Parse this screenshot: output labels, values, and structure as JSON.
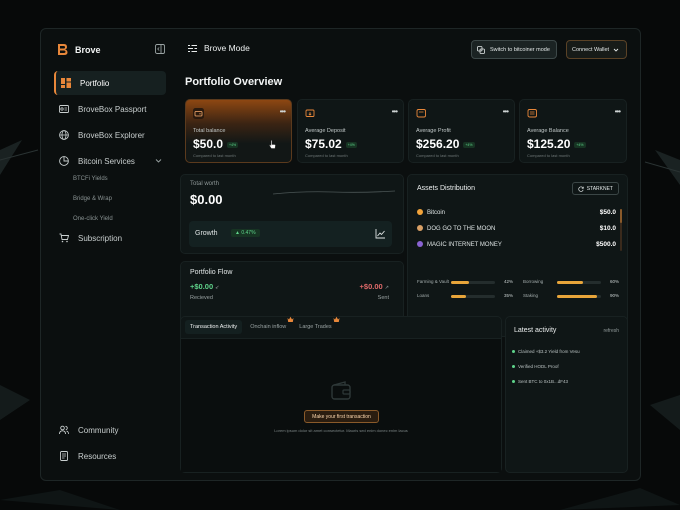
{
  "colors": {
    "accent": "#e8873a",
    "positive": "#5fd48b",
    "negative": "#e06a6a",
    "bar": "#e8a53a",
    "background": "#070909"
  },
  "brand": {
    "name": "Brove",
    "logo_icon": "brove-logo-icon"
  },
  "sidebar": {
    "items": [
      {
        "label": "Portfolio",
        "icon": "portfolio-grid-icon",
        "active": true
      },
      {
        "label": "BroveBox Passport",
        "icon": "passport-card-icon"
      },
      {
        "label": "BroveBox Explorer",
        "icon": "globe-icon"
      },
      {
        "label": "Bitcoin Services",
        "icon": "pie-chart-icon",
        "expanded": true,
        "children": [
          "BTCFi Yields",
          "Bridge & Wrap",
          "One-click Yield"
        ]
      },
      {
        "label": "Subscription",
        "icon": "cart-icon"
      }
    ],
    "bottom": [
      {
        "label": "Community",
        "icon": "users-icon"
      },
      {
        "label": "Resources",
        "icon": "document-icon"
      }
    ]
  },
  "header": {
    "mode_label": "Brove Mode",
    "switch_label": "Switch to bitcoiner mode",
    "connect_label": "Connect Wallet"
  },
  "page": {
    "title": "Portfolio Overview"
  },
  "stats": [
    {
      "label": "Total balance",
      "value": "$50.0",
      "change": "+4%",
      "sub": "Compared to last month"
    },
    {
      "label": "Average Deposit",
      "value": "$75.02",
      "change": "+4%",
      "sub": "Compared to last month"
    },
    {
      "label": "Average Profit",
      "value": "$256.20",
      "change": "+4%",
      "sub": "Compared to last month"
    },
    {
      "label": "Average Balance",
      "value": "$125.20",
      "change": "+4%",
      "sub": "Compared to last month"
    }
  ],
  "total_worth": {
    "label": "Total worth",
    "value": "$0.00",
    "growth_label": "Growth",
    "growth_change": "0.47%"
  },
  "portfolio_flow": {
    "title": "Portfolio Flow",
    "in_value": "+$0.00",
    "in_label": "Recieved",
    "out_value": "+$0.00",
    "out_label": "Sent"
  },
  "assets_distribution": {
    "title": "Assets Distribution",
    "network": "STARKNET",
    "assets": [
      {
        "name": "Bitcoin",
        "value": "$50.0",
        "color": "#f2a33a"
      },
      {
        "name": "DOG GO TO THE MOON",
        "value": "$10.0",
        "color": "#d9a066"
      },
      {
        "name": "MAGIC INTERNET MONEY",
        "value": "$500.0",
        "color": "#8a63d2"
      }
    ],
    "bars": [
      {
        "label": "Farming & Vault",
        "percent": "42%",
        "fraction": 0.42
      },
      {
        "label": "Borrowing",
        "percent": "60%",
        "fraction": 0.6
      },
      {
        "label": "Loans",
        "percent": "35%",
        "fraction": 0.35
      },
      {
        "label": "Staking",
        "percent": "90%",
        "fraction": 0.9
      }
    ]
  },
  "transactions": {
    "tabs": [
      "Transaction Activity",
      "Onchain inflow",
      "Large Trades"
    ],
    "empty_button": "Make your first transaction",
    "empty_text": "Lorem ipsum dolor sit amet consectetur. Mauris sed enim donec enim lacus"
  },
  "latest_activity": {
    "title": "Latest activity",
    "refresh_label": "refresh",
    "items": [
      "Claimed +$3.2 Yield from Vesu",
      "Verified HODL Proof",
      "Sent BTC to 0x1B...dF43"
    ]
  }
}
